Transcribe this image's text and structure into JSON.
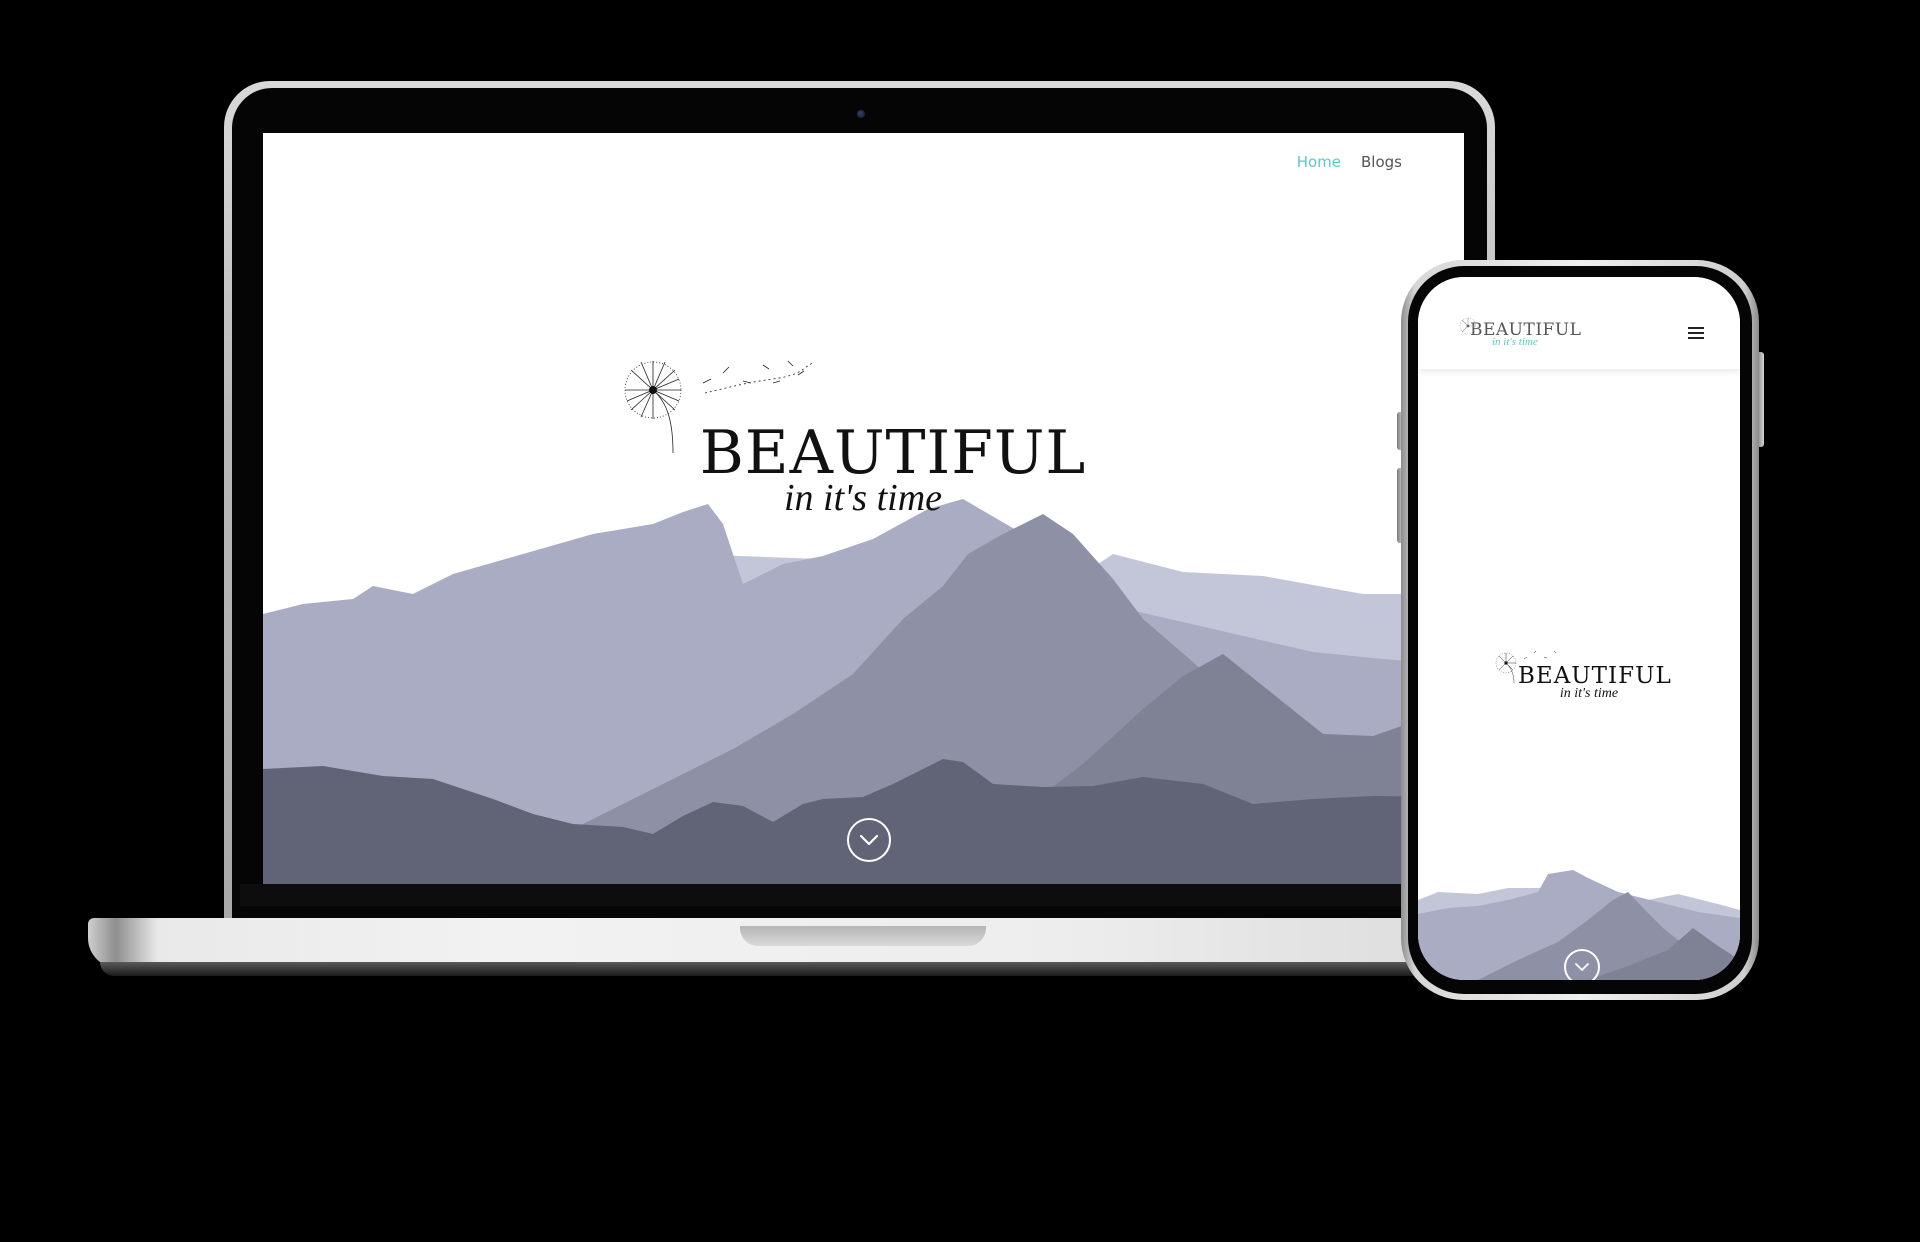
{
  "desktop": {
    "nav": {
      "items": [
        {
          "label": "Home",
          "active": true
        },
        {
          "label": "Blogs",
          "active": false
        }
      ]
    },
    "hero": {
      "logo_title": "BEAUTIFUL",
      "logo_subtitle": "in it's time",
      "scroll_icon": "chevron-down-circle-icon"
    }
  },
  "mobile": {
    "header": {
      "logo_title": "BEAUTIFUL",
      "logo_subtitle": "in it's time",
      "menu_icon": "hamburger-menu-icon"
    },
    "hero": {
      "logo_title": "BEAUTIFUL",
      "logo_subtitle": "in it's time",
      "scroll_icon": "chevron-down-circle-icon"
    }
  },
  "colors": {
    "accent_teal": "#5ec7c4",
    "mountain_far": "#c3c6d8",
    "mountain_mid": "#a9acc2",
    "mountain_near": "#8e90a6",
    "mountain_dark": "#616377"
  }
}
